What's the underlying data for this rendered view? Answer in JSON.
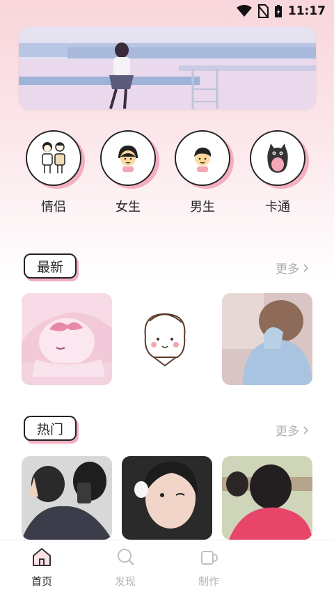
{
  "status": {
    "time": "11:17"
  },
  "categories": [
    {
      "label": "情侣",
      "icon": "couple-icon"
    },
    {
      "label": "女生",
      "icon": "girl-icon"
    },
    {
      "label": "男生",
      "icon": "boy-icon"
    },
    {
      "label": "卡通",
      "icon": "cartoon-cat-icon"
    }
  ],
  "sections": {
    "latest": {
      "title": "最新",
      "more": "更多"
    },
    "hot": {
      "title": "热门",
      "more": "更多"
    }
  },
  "nav": [
    {
      "label": "首页",
      "active": true
    },
    {
      "label": "发现",
      "active": false
    },
    {
      "label": "制作",
      "active": false
    }
  ],
  "colors": {
    "accent_pink": "#f3aec0",
    "active_nav": "#222222",
    "inactive_nav": "#b5b5b5"
  }
}
